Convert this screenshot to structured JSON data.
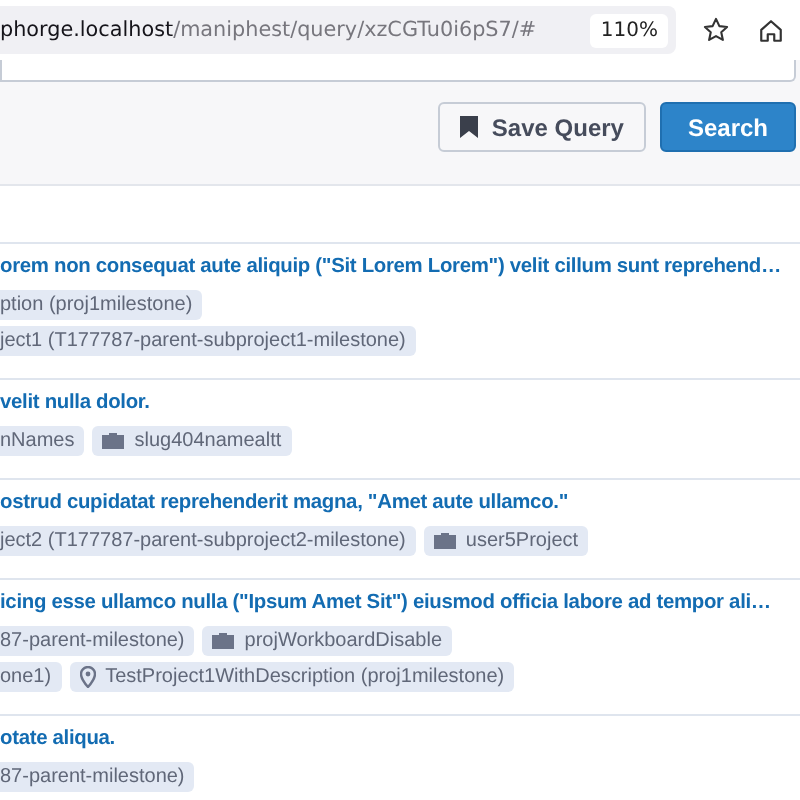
{
  "browser": {
    "url_host": "phorge.localhost",
    "url_path": "/maniphest/query/xzCGTu0i6pS7/#",
    "zoom": "110%"
  },
  "query_buttons": [
    {
      "label": "Save Query",
      "kind": "secondary"
    },
    {
      "label": "Search",
      "kind": "primary"
    }
  ],
  "tasks": [
    {
      "title": "orem non consequat aute aliquip (\"Sit Lorem Lorem\") velit cillum sunt reprehend…",
      "tag_lines": [
        [
          {
            "label": "ption (proj1milestone)",
            "kind": "plain"
          }
        ],
        [
          {
            "label": "ject1 (T177787-parent-subproject1-milestone)",
            "kind": "plain"
          }
        ]
      ]
    },
    {
      "title": "velit nulla dolor.",
      "tag_lines": [
        [
          {
            "label": "nNames",
            "kind": "plain"
          },
          {
            "label": "slug404namealtt",
            "kind": "project"
          }
        ]
      ]
    },
    {
      "title": "ostrud cupidatat reprehenderit magna, \"Amet aute ullamco.\"",
      "tag_lines": [
        [
          {
            "label": "ject2 (T177787-parent-subproject2-milestone)",
            "kind": "plain"
          },
          {
            "label": "user5Project",
            "kind": "project"
          }
        ]
      ]
    },
    {
      "title": "icing esse ullamco nulla (\"Ipsum Amet Sit\") eiusmod officia labore ad tempor ali…",
      "tag_lines": [
        [
          {
            "label": "87-parent-milestone)",
            "kind": "plain"
          },
          {
            "label": "projWorkboardDisable",
            "kind": "project"
          }
        ],
        [
          {
            "label": "one1)",
            "kind": "plain"
          },
          {
            "label": "TestProject1WithDescription (proj1milestone)",
            "kind": "milestone"
          }
        ]
      ]
    },
    {
      "title": "otate aliqua.",
      "tag_lines": [
        [
          {
            "label": "87-parent-milestone)",
            "kind": "plain"
          }
        ]
      ]
    }
  ]
}
